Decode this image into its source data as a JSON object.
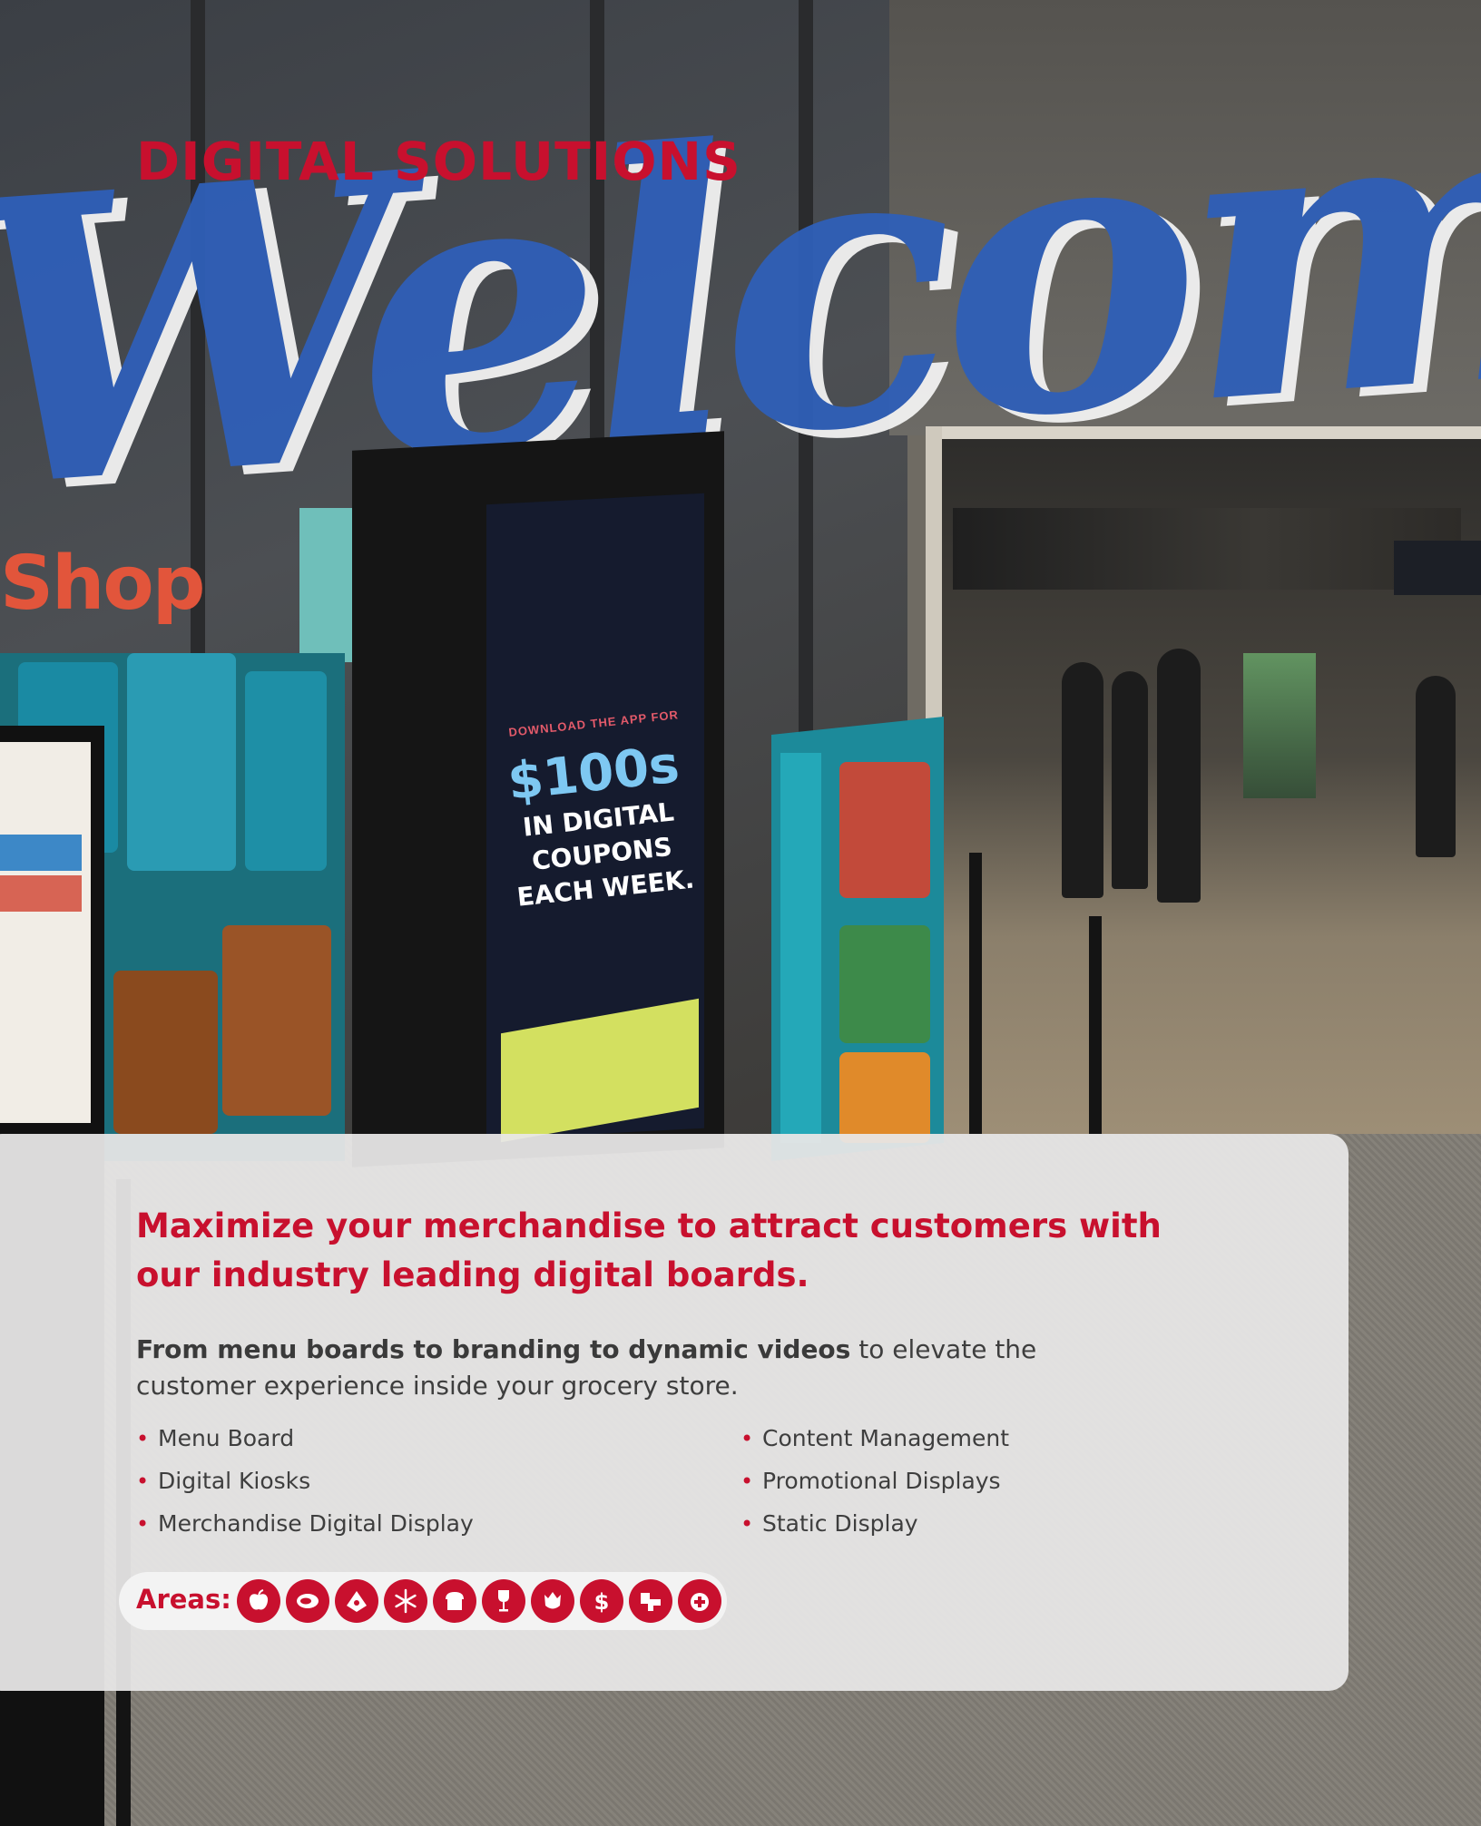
{
  "header": {
    "title": "DIGITAL SOLUTIONS"
  },
  "photo": {
    "welcome_word": "Welcome",
    "shop_word": "Shop",
    "kiosk_top": "DOWNLOAD THE APP FOR",
    "kiosk_big": "$100s",
    "kiosk_line1": "IN DIGITAL",
    "kiosk_line2": "COUPONS",
    "kiosk_line3": "EACH WEEK."
  },
  "panel": {
    "subhead": "Maximize your merchandise to attract customers with our industry leading digital boards.",
    "desc_bold": "From menu boards to branding to dynamic videos",
    "desc_rest": " to elevate the customer experience inside your grocery store.",
    "list_left": [
      "Menu Board",
      "Digital Kiosks",
      "Merchandise Digital Display"
    ],
    "list_right": [
      "Content Management",
      "Promotional Displays",
      "Static Display"
    ],
    "areas_label": "Areas:",
    "area_icons": [
      "apple-icon",
      "meat-icon",
      "deli-icon",
      "snowflake-icon",
      "bread-icon",
      "wine-glass-icon",
      "flower-icon",
      "dollar-icon",
      "pharmacy-icon",
      "health-icon"
    ]
  },
  "colors": {
    "brand_red": "#c8102e",
    "panel_bg": "#e8e7e7",
    "text_dark": "#3e3e3e"
  }
}
